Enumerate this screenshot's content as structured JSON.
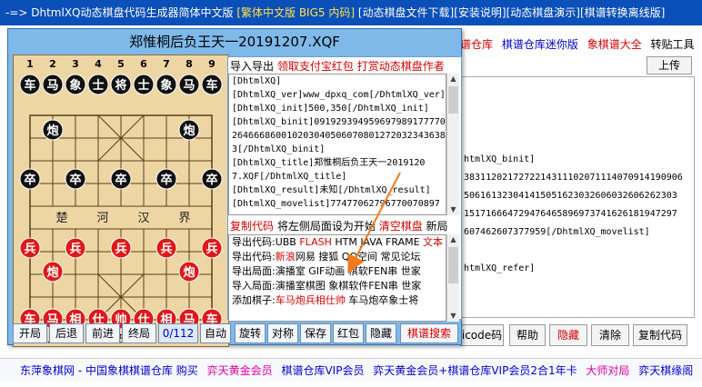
{
  "topbar": {
    "prefix": "-=> DhtmlXQ动态棋盘代码生成器简体中文版",
    "highlight": "[繁体中文版 BIG5 内码]",
    "links": "[动态棋盘文件下载][安装说明][动态棋盘演示][棋谱转换离线版]"
  },
  "background": {
    "toplinks": {
      "l1": "谱仓库",
      "l2": "棋谱仓库迷你版",
      "l3": "象棋谱大全",
      "l4": "转贴工具"
    },
    "upload_label": "上传",
    "code_lines": [
      "htmlXQ_binit]",
      "3831120217272214311102071114070914190906",
      "506161323041415051623032606032606262303",
      "151716664729476465896973741626181947297",
      "607462607377959[/DhtmlXQ_movelist]",
      "",
      "htmlXQ_refer]"
    ],
    "buttons": {
      "icode": "icode码",
      "help": "帮助",
      "hide": "隐藏",
      "clear": "清除",
      "copy": "复制代码"
    }
  },
  "bottom_links": {
    "l1": "东萍象棋网 - 中国象棋棋谱仓库 购买",
    "l2": "弈天黄金会员",
    "l3": "棋谱仓库VIP会员",
    "l4": "弈天黄金会员+棋谱仓库VIP会员2合1年卡",
    "l5": "大师对局",
    "l6": "弈天棋缘阁"
  },
  "dialog": {
    "title": "郑惟桐后负王天一20191207.XQF",
    "header": {
      "t1": "导入导出",
      "t2": "领取支付宝红包",
      "t3": "打赏动态棋盘作者"
    },
    "code_lines": [
      "[DhtmlXQ]",
      "[DhtmlXQ_ver]www_dpxq_com[/DhtmlXQ_ver]",
      "[DhtmlXQ_init]500,350[/DhtmlXQ_init]",
      "[DhtmlXQ_binit]0919293949596979891777706",
      "2646668600102030405060708012720323436383",
      "3[/DhtmlXQ_binit]",
      "[DhtmlXQ_title]郑惟桐后负王天一2019120",
      "7.XQF[/DhtmlXQ_title]",
      "[DhtmlXQ_result]未知[/DhtmlXQ_result]",
      "[DhtmlXQ_movelist]77477062796770070897"
    ],
    "mid": {
      "copy": "复制代码",
      "set_start": "将左侧局面设为开始",
      "clear": "清空棋盘",
      "new": "新局"
    },
    "export_lines": [
      {
        "a": "导出代码:UBB ",
        "b": "FLASH",
        "c": " HTM JAVA FRAME ",
        "d": "文本"
      },
      {
        "a": "导出代码:",
        "b": "新浪",
        "c": "网易 搜狐 QQ空间 常见论坛",
        "d": ""
      },
      {
        "a": "导出局面:演播室 GIF动画 棋软FEN串 世家",
        "b": "",
        "c": "",
        "d": ""
      },
      {
        "a": "导入局面:演播室棋图 象棋软件FEN串 世家",
        "b": "",
        "c": "",
        "d": ""
      },
      {
        "a": "添加棋子:",
        "b": "车马炮兵相仕帅",
        "c": " 车马炮卒象士将",
        "d": ""
      }
    ],
    "buttons": {
      "start": "开局",
      "back": "后退",
      "forward": "前进",
      "end": "终局",
      "counter": "0/112",
      "auto": "自动",
      "rotate": "旋转",
      "mirror": "对称",
      "save": "保存",
      "redpack": "红包",
      "hide": "隐藏",
      "search": "棋谱搜索"
    }
  },
  "board": {
    "top_numbers": [
      "1",
      "2",
      "3",
      "4",
      "5",
      "6",
      "7",
      "8",
      "9"
    ],
    "bottom_numbers": [
      "九",
      "八",
      "七",
      "六",
      "五",
      "四",
      "三",
      "二",
      "一"
    ],
    "river": [
      "楚",
      "河",
      "汉",
      "界"
    ],
    "black_back_row": [
      "车",
      "马",
      "象",
      "士",
      "将",
      "士",
      "象",
      "马",
      "车"
    ],
    "red_back_row": [
      "车",
      "马",
      "相",
      "仕",
      "帅",
      "仕",
      "相",
      "马",
      "车"
    ],
    "black_cannon": "炮",
    "red_cannon": "炮",
    "black_pawn": "卒",
    "red_pawn": "兵",
    "colors": {
      "black_piece": "#111111",
      "red_piece": "#e01818",
      "board": "#eed6a4",
      "line": "#5a3e1a"
    }
  }
}
